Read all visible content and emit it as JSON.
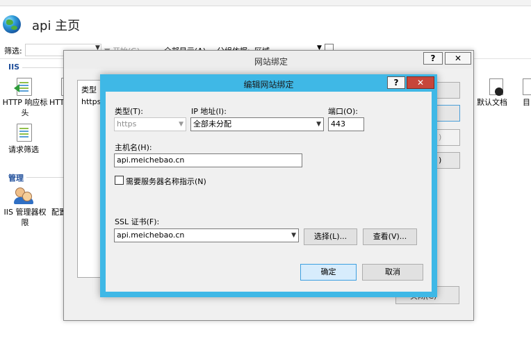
{
  "page": {
    "title": "api 主页"
  },
  "toolbar": {
    "filter_label": "筛选:",
    "start": "开始(G)",
    "show_all": "全部显示(A)",
    "group_by": "分组依据:",
    "group_value": "区域"
  },
  "sections": {
    "iis": "IIS",
    "management": "管理"
  },
  "features": {
    "http_response_headers": "HTTP 响应标头",
    "http_cut": "HTT",
    "request_filtering": "请求筛选",
    "iis_manager_permissions": "IIS 管理器权限",
    "config_cut": "配置",
    "default_document": "默认文档",
    "cut_right": "目"
  },
  "site_bindings": {
    "title": "网站绑定",
    "help": "?",
    "close": "✕",
    "column_type": "类型",
    "row_type": "https",
    "side_fragments": [
      "",
      "",
      ")",
      ")"
    ],
    "close_button_fragment": "关闭(C)"
  },
  "edit_binding": {
    "title": "编辑网站绑定",
    "help": "?",
    "close": "✕",
    "type_label": "类型(T):",
    "type_value": "https",
    "ip_label": "IP 地址(I):",
    "ip_value": "全部未分配",
    "port_label": "端口(O):",
    "port_value": "443",
    "host_label": "主机名(H):",
    "host_value": "api.meichebao.cn",
    "sni_label": "需要服务器名称指示(N)",
    "sni_checked": false,
    "ssl_label": "SSL 证书(F):",
    "ssl_value": "api.meichebao.cn",
    "select_button": "选择(L)...",
    "view_button": "查看(V)...",
    "ok_button": "确定",
    "cancel_button": "取消"
  }
}
